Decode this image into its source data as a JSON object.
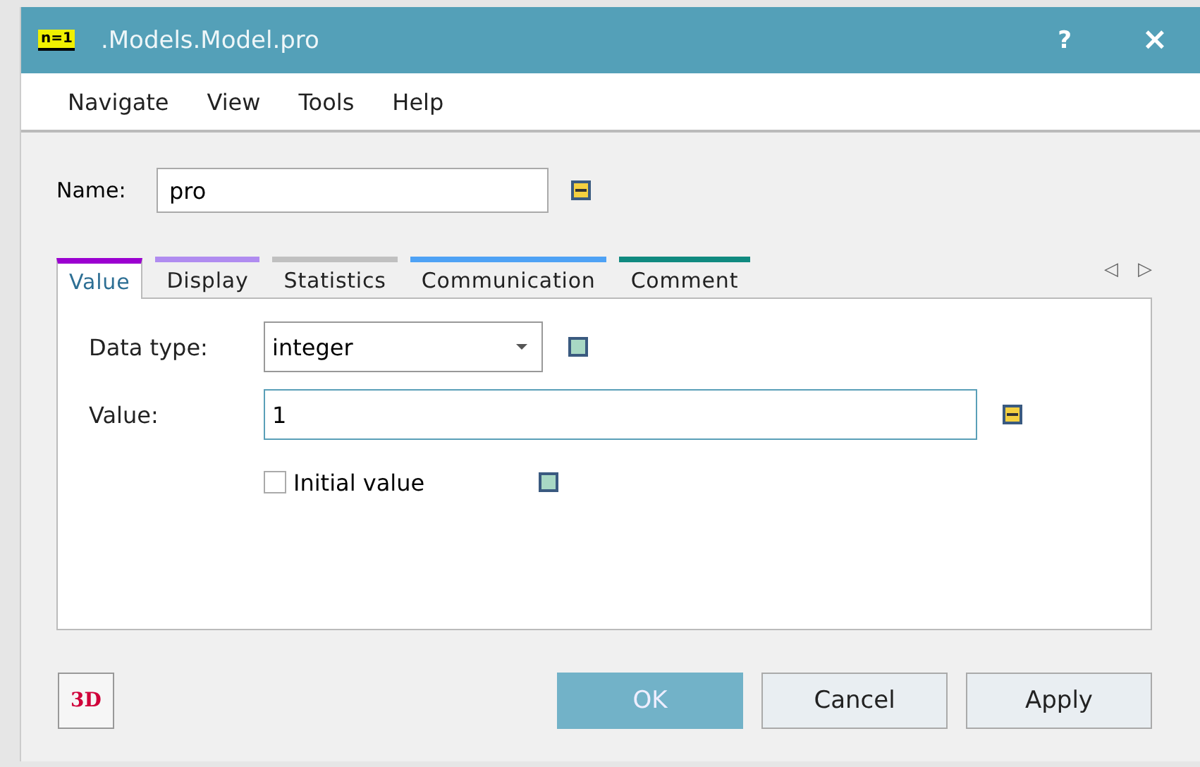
{
  "window": {
    "logo": "n=1",
    "title": ".Models.Model.pro",
    "help": "?",
    "close": "×"
  },
  "menu": [
    "Navigate",
    "View",
    "Tools",
    "Help"
  ],
  "name_field": {
    "label": "Name:",
    "value": "pro",
    "marker_minus": true
  },
  "tabs": [
    {
      "label": "Value",
      "selected": true,
      "color": "#9b00d0"
    },
    {
      "label": "Display",
      "selected": false,
      "color": "#b08cf0"
    },
    {
      "label": "Statistics",
      "selected": false,
      "color": "#c0c0c0"
    },
    {
      "label": "Communication",
      "selected": false,
      "color": "#4ea2f5"
    },
    {
      "label": "Comment",
      "selected": false,
      "color": "#108a80"
    }
  ],
  "tab_scroll": {
    "left": "◁",
    "right": "▷"
  },
  "fields": [
    {
      "kind": "dropdown",
      "label": "Data type:",
      "value": "integer",
      "marker_minus": false
    },
    {
      "kind": "text",
      "label": "Value:",
      "value": "1",
      "marker_minus": true
    },
    {
      "kind": "checkbox",
      "label": "Initial value",
      "checked": false,
      "marker_minus": false
    }
  ],
  "footer": {
    "badge": "3D",
    "buttons": [
      {
        "label": "OK",
        "default": true
      },
      {
        "label": "Cancel",
        "default": false
      },
      {
        "label": "Apply",
        "default": false
      }
    ]
  }
}
